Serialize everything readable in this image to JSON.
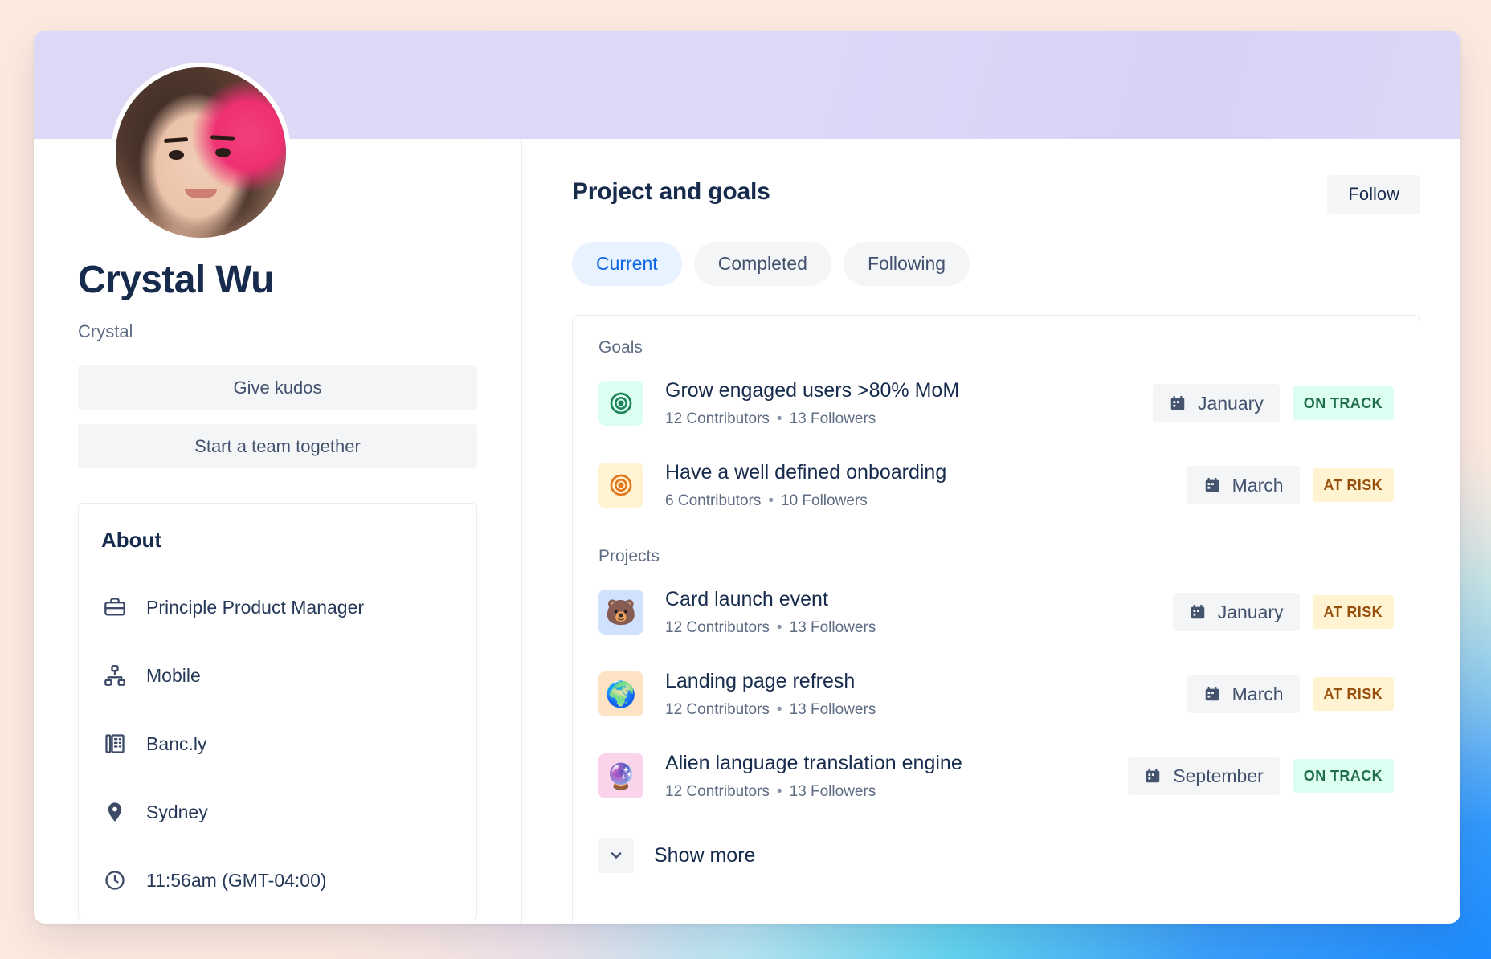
{
  "profile": {
    "name": "Crystal Wu",
    "handle": "Crystal",
    "avatar_alt": "avatar",
    "actions": {
      "give_kudos": "Give kudos",
      "start_team": "Start a team together"
    },
    "about": {
      "title": "About",
      "items": [
        {
          "icon": "briefcase-icon",
          "label": "Principle Product Manager"
        },
        {
          "icon": "org-chart-icon",
          "label": "Mobile"
        },
        {
          "icon": "building-icon",
          "label": "Banc.ly"
        },
        {
          "icon": "location-pin-icon",
          "label": "Sydney"
        },
        {
          "icon": "clock-icon",
          "label": "11:56am (GMT-04:00)"
        }
      ]
    }
  },
  "main": {
    "title": "Project and goals",
    "follow_label": "Follow",
    "tabs": [
      {
        "label": "Current",
        "active": true
      },
      {
        "label": "Completed",
        "active": false
      },
      {
        "label": "Following",
        "active": false
      }
    ],
    "groups": [
      {
        "label": "Goals",
        "rows": [
          {
            "icon": "target-icon",
            "icon_bg": "#dcfff1",
            "icon_color": "#1f845a",
            "title": "Grow engaged users >80% MoM",
            "contributors": "12 Contributors",
            "separator": "•",
            "followers": "13 Followers",
            "date": "January",
            "status": "ON TRACK",
            "status_kind": "ontrack"
          },
          {
            "icon": "target-icon",
            "icon_bg": "#fff3d1",
            "icon_color": "#e2761b",
            "title": "Have a well defined onboarding",
            "contributors": "6 Contributors",
            "separator": "•",
            "followers": "10 Followers",
            "date": "March",
            "status": "AT RISK",
            "status_kind": "atrisk"
          }
        ]
      },
      {
        "label": "Projects",
        "rows": [
          {
            "icon": "bear-emoji",
            "emoji": "🐻",
            "icon_bg": "#cfe1fd",
            "title": "Card launch event",
            "contributors": "12 Contributors",
            "separator": "•",
            "followers": "13 Followers",
            "date": "January",
            "status": "AT RISK",
            "status_kind": "atrisk"
          },
          {
            "icon": "globe-emoji",
            "emoji": "🌍",
            "icon_bg": "#fde3c4",
            "title": "Landing page refresh",
            "contributors": "12 Contributors",
            "separator": "•",
            "followers": "13 Followers",
            "date": "March",
            "status": "AT RISK",
            "status_kind": "atrisk"
          },
          {
            "icon": "crystal-ball-emoji",
            "emoji": "🔮",
            "icon_bg": "#fbd3ea",
            "title": "Alien language translation engine",
            "contributors": "12 Contributors",
            "separator": "•",
            "followers": "13 Followers",
            "date": "September",
            "status": "ON TRACK",
            "status_kind": "ontrack"
          }
        ]
      }
    ],
    "show_more_label": "Show more"
  },
  "colors": {
    "accent_blue": "#0c66e4",
    "text_primary": "#172b4d",
    "text_muted": "#5e6c84",
    "on_track_bg": "#dcfff1",
    "on_track_fg": "#216e4e",
    "at_risk_bg": "#fff3d1",
    "at_risk_fg": "#974f0c",
    "banner": "#ded9f7"
  }
}
